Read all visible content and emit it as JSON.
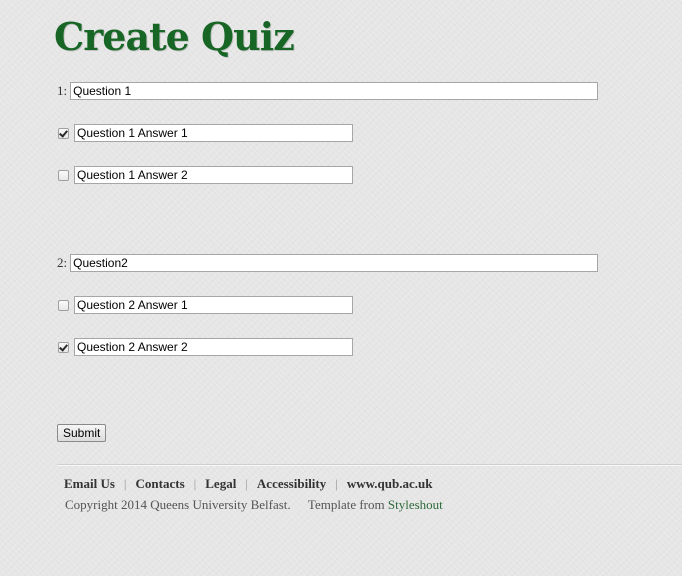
{
  "page": {
    "title": "Create Quiz"
  },
  "questions": [
    {
      "number_label": "1:",
      "value": "Question 1",
      "answers": [
        {
          "value": "Question 1 Answer 1",
          "checked": true
        },
        {
          "value": "Question 1 Answer 2",
          "checked": false
        }
      ]
    },
    {
      "number_label": "2:",
      "value": "Question2",
      "answers": [
        {
          "value": "Question 2 Answer 1",
          "checked": false
        },
        {
          "value": "Question 2 Answer 2",
          "checked": true
        }
      ]
    }
  ],
  "form": {
    "submit_label": "Submit"
  },
  "footer": {
    "links": [
      "Email Us",
      "Contacts",
      "Legal",
      "Accessibility",
      "www.qub.ac.uk"
    ],
    "separator": "|",
    "copyright": "Copyright 2014 Queens University Belfast.",
    "template_text": "Template from",
    "template_link": "Styleshout"
  },
  "colors": {
    "title": "#176626",
    "link": "#2f6b3c",
    "background": "#e6e6e6"
  }
}
